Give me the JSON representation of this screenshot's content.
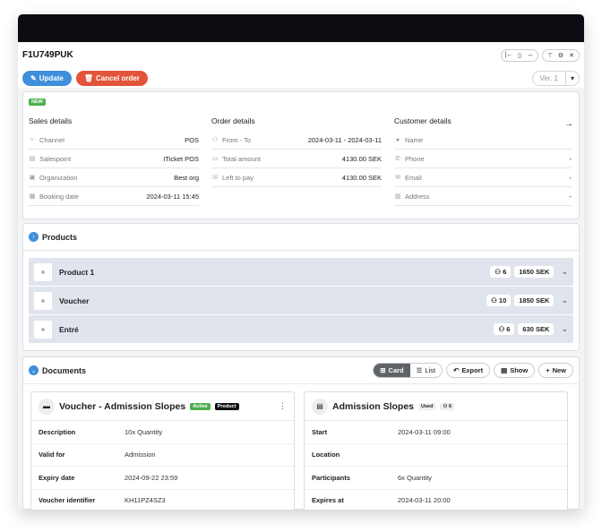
{
  "window": {
    "order_id": "F1U749PUK",
    "controls": [
      "collapse-left-icon",
      "mobile-icon",
      "expand-width-icon",
      "pin-icon",
      "gear-icon",
      "close-icon"
    ]
  },
  "actions": {
    "update_label": "Update",
    "cancel_label": "Cancel order",
    "version_label": "Ver. 1"
  },
  "summary": {
    "badge": "NEW",
    "sales": {
      "title": "Sales details",
      "rows": [
        {
          "label": "Channel",
          "value": "POS"
        },
        {
          "label": "Salespoint",
          "value": "ITicket POS"
        },
        {
          "label": "Organization",
          "value": "Best org"
        },
        {
          "label": "Booking date",
          "value": "2024-03-11 15:45"
        }
      ]
    },
    "order": {
      "title": "Order details",
      "rows": [
        {
          "label": "From - To",
          "value": "2024-03-11 - 2024-03-11"
        },
        {
          "label": "Total amount",
          "value": "4130.00 SEK"
        },
        {
          "label": "Left to pay",
          "value": "4130.00 SEK"
        }
      ]
    },
    "customer": {
      "title": "Customer details",
      "rows": [
        {
          "label": "Name",
          "value": ""
        },
        {
          "label": "Phone",
          "value": "-"
        },
        {
          "label": "Email",
          "value": "-"
        },
        {
          "label": "Address",
          "value": "-"
        }
      ]
    }
  },
  "products": {
    "title": "Products",
    "items": [
      {
        "name": "Product 1",
        "qty": "6",
        "price": "1650 SEK"
      },
      {
        "name": "Voucher",
        "qty": "10",
        "price": "1850 SEK"
      },
      {
        "name": "Entré",
        "qty": "6",
        "price": "630 SEK"
      }
    ]
  },
  "documents": {
    "title": "Documents",
    "view_card": "Card",
    "view_list": "List",
    "export_label": "Export",
    "show_label": "Show",
    "new_label": "New",
    "cards": [
      {
        "title": "Voucher - Admission Slopes",
        "status": "Active",
        "type": "Product",
        "rows": [
          {
            "key": "Description",
            "value": "10x Quantity"
          },
          {
            "key": "Valid for",
            "value": "Admission"
          },
          {
            "key": "Expiry date",
            "value": "2024-09-22 23:59"
          },
          {
            "key": "Voucher identifier",
            "value": "KH11PZ4SZ3"
          }
        ]
      },
      {
        "title": "Admission Slopes",
        "status": "Used",
        "count": "6",
        "rows": [
          {
            "key": "Start",
            "value": "2024-03-11 09:00"
          },
          {
            "key": "Location",
            "value": ""
          },
          {
            "key": "Participants",
            "value": "6x Quantity"
          },
          {
            "key": "Expires at",
            "value": "2024-03-11 20:00"
          }
        ]
      }
    ]
  }
}
